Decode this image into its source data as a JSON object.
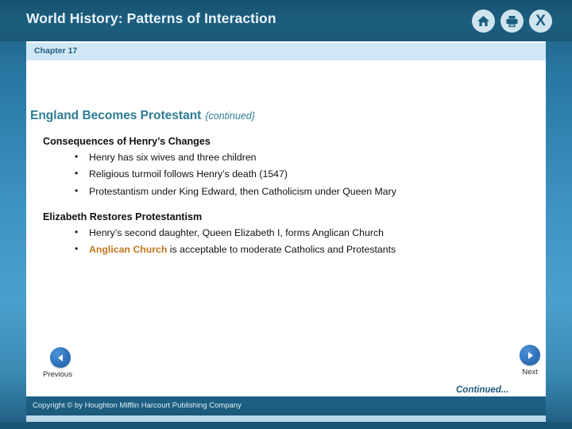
{
  "header": {
    "title": "World History: Patterns of Interaction",
    "icons": [
      {
        "name": "home-icon",
        "label": "Home"
      },
      {
        "name": "print-icon",
        "label": "Print"
      },
      {
        "name": "close-icon",
        "label": "X"
      }
    ]
  },
  "chapter": {
    "label": "Chapter 17"
  },
  "slide": {
    "heading": "England Becomes Protestant",
    "heading_note": "{continued}",
    "heading_color": "#2d7c94",
    "highlight_color": "#c0761d",
    "sections": [
      {
        "title": "Consequences of Henry’s Changes",
        "bullets": [
          {
            "text": "Henry has six wives and three children"
          },
          {
            "text": "Religious turmoil follows Henry’s death (1547)"
          },
          {
            "text": "Protestantism under King Edward, then Catholicism under Queen Mary"
          }
        ]
      },
      {
        "title": "Elizabeth Restores Protestantism",
        "bullets": [
          {
            "text": "Henry’s second daughter, Queen Elizabeth I, forms Anglican Church"
          },
          {
            "highlight": "Anglican Church",
            "text": " is acceptable to moderate Catholics and Protestants"
          }
        ]
      }
    ]
  },
  "nav": {
    "previous_label": "Previous",
    "next_label": "Next",
    "continued_label": "Continued..."
  },
  "footer": {
    "copyright": "Copyright © by Houghton Mifflin Harcourt Publishing Company"
  }
}
